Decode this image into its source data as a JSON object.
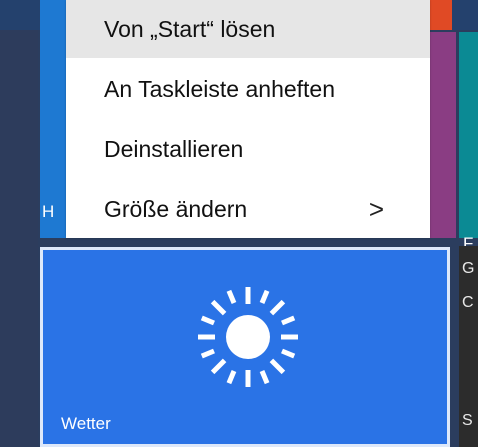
{
  "context_menu": {
    "items": [
      {
        "label": "Von „Start“ lösen",
        "highlighted": true
      },
      {
        "label": "An Taskleiste anheften",
        "highlighted": false
      },
      {
        "label": "Deinstallieren",
        "highlighted": false
      },
      {
        "label": "Größe ändern",
        "highlighted": false,
        "submenu_icon": "chevron-right-icon",
        "submenu_glyph": ">"
      }
    ]
  },
  "tiles": {
    "weather": {
      "label": "Wetter",
      "icon": "sun-icon",
      "color": "#2a73e6"
    },
    "left_partial": {
      "label": "H",
      "color": "#1e79d2"
    },
    "teal_partial": {
      "label": "F",
      "color": "#0b8a94"
    },
    "purple_partial": {
      "color": "#8a3d83"
    },
    "orange_partial": {
      "color": "#e04a25"
    },
    "right_dark_partial": {
      "glyphs": [
        "G",
        "C",
        "S"
      ],
      "color": "#2c2c2c"
    }
  },
  "colors": {
    "background": "#2b3d5e",
    "menu_background": "#ffffff",
    "menu_hover": "#e6e6e6"
  }
}
